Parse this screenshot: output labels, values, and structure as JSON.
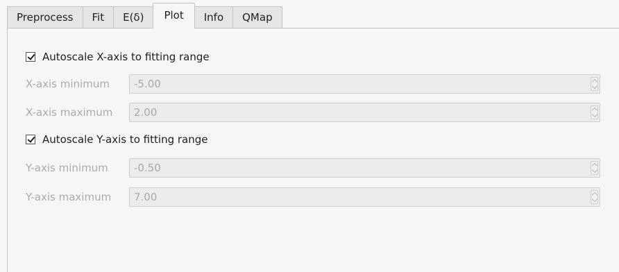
{
  "tabs": [
    {
      "label": "Preprocess"
    },
    {
      "label": "Fit"
    },
    {
      "label": "E(δ)"
    },
    {
      "label": "Plot"
    },
    {
      "label": "Info"
    },
    {
      "label": "QMap"
    }
  ],
  "active_tab": "Plot",
  "x_axis": {
    "autoscale_label": "Autoscale X-axis to fitting range",
    "autoscale_checked": true,
    "min_label": "X-axis minimum",
    "min_value": "-5.00",
    "max_label": "X-axis maximum",
    "max_value": "2.00"
  },
  "y_axis": {
    "autoscale_label": "Autoscale Y-axis to fitting range",
    "autoscale_checked": true,
    "min_label": "Y-axis minimum",
    "min_value": "-0.50",
    "max_label": "Y-axis maximum",
    "max_value": "7.00"
  },
  "icons": {
    "checkbox": "checkmark-icon",
    "spin": "chevron-up-down-icon"
  },
  "colors": {
    "background": "#f6f6f6",
    "disabled_text": "#ababab",
    "tab_inactive": "#e5e5e5"
  }
}
